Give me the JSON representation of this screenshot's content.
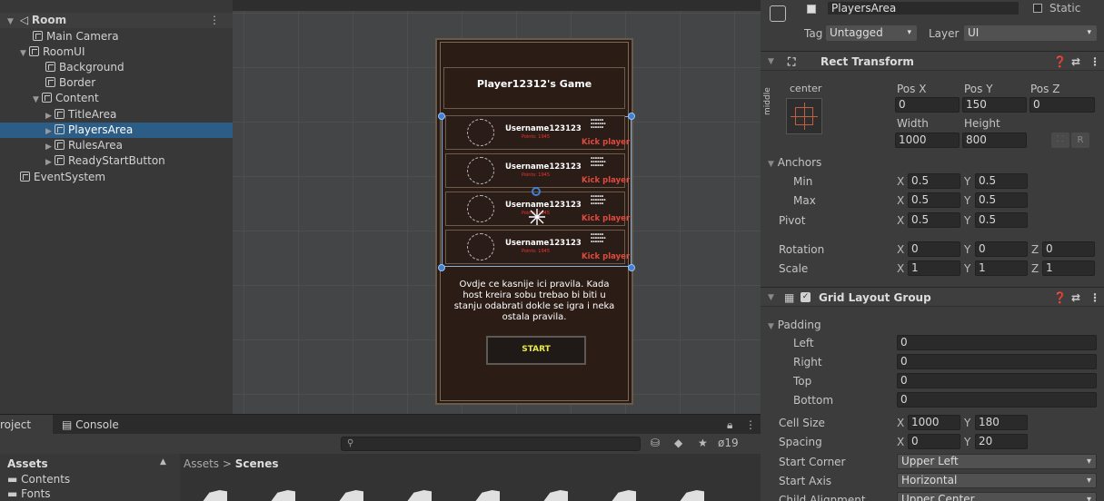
{
  "hierarchy": {
    "root": "Room",
    "items": [
      "Main Camera",
      "RoomUI",
      "Background",
      "Border",
      "Content",
      "TitleArea",
      "PlayersArea",
      "RulesArea",
      "ReadyStartButton",
      "EventSystem"
    ]
  },
  "scene": {
    "title": "Player12312's Game",
    "players": [
      {
        "name": "Username123123",
        "points": "Points: 1945",
        "kick": "Kick player"
      },
      {
        "name": "Username123123",
        "points": "Points: 1945",
        "kick": "Kick player"
      },
      {
        "name": "Username123123",
        "points": "Points: 1945",
        "kick": "Kick player"
      },
      {
        "name": "Username123123",
        "points": "Points: 1945",
        "kick": "Kick player"
      }
    ],
    "rules": "Ovdje ce kasnije ici pravila. Kada host kreira sobu trebao bi biti u stanju odabrati dokle se igra i neka ostala pravila.",
    "start": "START"
  },
  "inspector": {
    "object_name": "PlayersArea",
    "static_label": "Static",
    "tag_label": "Tag",
    "tag_value": "Untagged",
    "layer_label": "Layer",
    "layer_value": "UI",
    "rect": {
      "title": "Rect Transform",
      "anchor_preset": "center",
      "middle": "middle",
      "posx_label": "Pos X",
      "posy_label": "Pos Y",
      "posz_label": "Pos Z",
      "posx": "0",
      "posy": "150",
      "posz": "0",
      "width_label": "Width",
      "height_label": "Height",
      "width": "1000",
      "height": "800",
      "r_button": "R",
      "anchors": "Anchors",
      "min": "Min",
      "max": "Max",
      "pivot": "Pivot",
      "min_x": "0.5",
      "min_y": "0.5",
      "max_x": "0.5",
      "max_y": "0.5",
      "pivot_x": "0.5",
      "pivot_y": "0.5",
      "rotation": "Rotation",
      "scale": "Scale",
      "rot_x": "0",
      "rot_y": "0",
      "rot_z": "0",
      "scale_x": "1",
      "scale_y": "1",
      "scale_z": "1"
    },
    "grid": {
      "title": "Grid Layout Group",
      "padding": "Padding",
      "left": "Left",
      "right": "Right",
      "top": "Top",
      "bottom": "Bottom",
      "left_v": "0",
      "right_v": "0",
      "top_v": "0",
      "bottom_v": "0",
      "cell_size": "Cell Size",
      "cell_x": "1000",
      "cell_y": "180",
      "spacing": "Spacing",
      "sp_x": "0",
      "sp_y": "20",
      "start_corner": "Start Corner",
      "start_corner_v": "Upper Left",
      "start_axis": "Start Axis",
      "start_axis_v": "Horizontal",
      "child_alignment": "Child Alignment",
      "child_alignment_v": "Upper Center"
    }
  },
  "bottom": {
    "tab_project": "roject",
    "tab_console": "Console",
    "search_placeholder": "",
    "hidden_count": "19",
    "assets_label": "Assets",
    "folders": [
      "Contents",
      "Fonts"
    ],
    "breadcrumb_root": "Assets",
    "breadcrumb_sep": ">",
    "breadcrumb_current": "Scenes"
  }
}
